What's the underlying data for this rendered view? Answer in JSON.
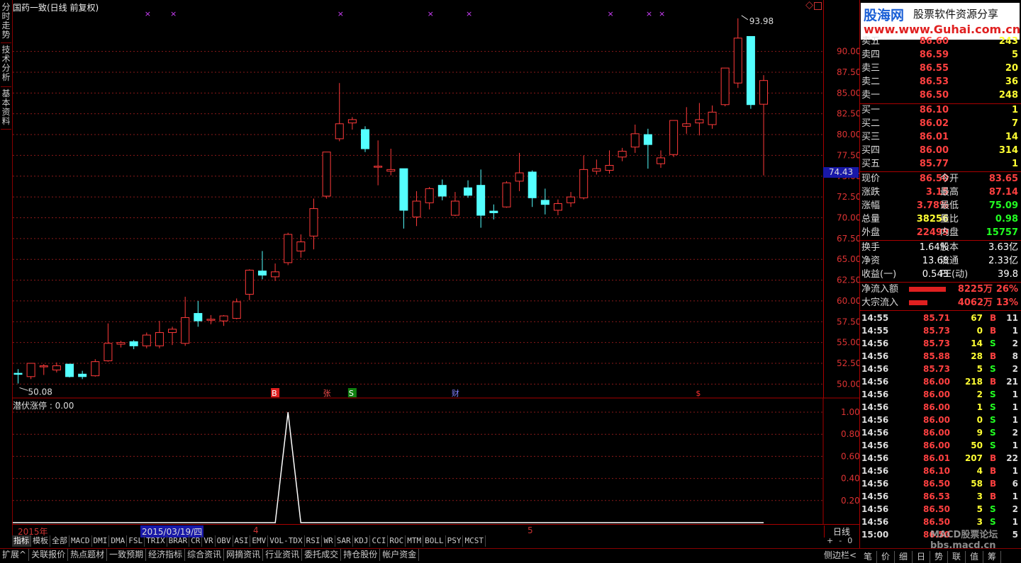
{
  "vertical_tabs": [
    "分时走势",
    "技术分析",
    "基本资料"
  ],
  "chart_title": "国药一致(日线 前复权)",
  "price_axis_labels": [
    "90.00",
    "87.50",
    "85.00",
    "82.50",
    "80.00",
    "77.50",
    "75.00",
    "72.50",
    "70.00",
    "67.50",
    "65.00",
    "62.50",
    "60.00",
    "57.50",
    "55.00",
    "52.50",
    "50.00"
  ],
  "last_price_marker": "74.43",
  "high_label": "93.98",
  "low_label": "50.08",
  "event_markers": {
    "b": "B",
    "zhang": "张",
    "s": "S",
    "cai": "财",
    "dollar": "$"
  },
  "indicator": {
    "label": "潜伏涨停 : 0.00",
    "axis_labels": [
      "1.00",
      "0.80",
      "0.60",
      "0.40",
      "0.20"
    ]
  },
  "date_bar": {
    "year": "2015年",
    "cursor_date": "2015/03/19/四",
    "month4": "4",
    "month5": "5",
    "period": "日线",
    "side_btns": [
      "+",
      "-",
      "0"
    ]
  },
  "indicator_tabs": [
    "指标",
    "模板",
    "全部",
    "MACD",
    "DMI",
    "DMA",
    "FSL",
    "TRIX",
    "BRAR",
    "CR",
    "VR",
    "OBV",
    "ASI",
    "EMV",
    "VOL-TDX",
    "RSI",
    "WR",
    "SAR",
    "KDJ",
    "CCI",
    "ROC",
    "MTM",
    "BOLL",
    "PSY",
    "MCST"
  ],
  "bottom_tabs": [
    "扩展^",
    "关联报价",
    "热点题材",
    "一致预期",
    "经济指标",
    "综合资讯",
    "网摘资讯",
    "行业资讯",
    "委托成交",
    "持仓股份",
    "帐户资金"
  ],
  "side_toggle": "侧边栏<",
  "side_bottom_tabs": [
    "笔",
    "价",
    "细",
    "日",
    "势",
    "联",
    "值",
    "筹"
  ],
  "logo": {
    "brand": "股海网",
    "slogan": "股票软件资源分享",
    "url": "www.Guhai.com.cn"
  },
  "watermark": "MACD股票论坛 bbs.macd.cn",
  "order_book": {
    "sells": [
      {
        "label": "卖五",
        "price": "86.60",
        "vol": "243"
      },
      {
        "label": "卖四",
        "price": "86.59",
        "vol": "5"
      },
      {
        "label": "卖三",
        "price": "86.55",
        "vol": "20"
      },
      {
        "label": "卖二",
        "price": "86.53",
        "vol": "36"
      },
      {
        "label": "卖一",
        "price": "86.50",
        "vol": "248"
      }
    ],
    "buys": [
      {
        "label": "买一",
        "price": "86.10",
        "vol": "1"
      },
      {
        "label": "买二",
        "price": "86.02",
        "vol": "7"
      },
      {
        "label": "买三",
        "price": "86.01",
        "vol": "14"
      },
      {
        "label": "买四",
        "price": "86.00",
        "vol": "314"
      },
      {
        "label": "买五",
        "price": "85.77",
        "vol": "1"
      }
    ]
  },
  "quote": [
    {
      "l1": "现价",
      "v1": "86.50",
      "l2": "今开",
      "v2": "83.65",
      "c1": "red",
      "c2": "red"
    },
    {
      "l1": "涨跌",
      "v1": "3.15",
      "l2": "最高",
      "v2": "87.14",
      "c1": "red",
      "c2": "red"
    },
    {
      "l1": "涨幅",
      "v1": "3.78%",
      "l2": "最低",
      "v2": "75.09",
      "c1": "red",
      "c2": "green"
    },
    {
      "l1": "总量",
      "v1": "38256",
      "l2": "量比",
      "v2": "0.98",
      "c1": "yellow",
      "c2": "green"
    },
    {
      "l1": "外盘",
      "v1": "22499",
      "l2": "内盘",
      "v2": "15757",
      "c1": "red",
      "c2": "green"
    }
  ],
  "fundamentals": [
    {
      "l1": "换手",
      "v1": "1.64%",
      "l2": "股本",
      "v2": "3.63亿"
    },
    {
      "l1": "净资",
      "v1": "13.68",
      "l2": "流通",
      "v2": "2.33亿"
    },
    {
      "l1": "收益(一)",
      "v1": "0.543",
      "l2": "PE(动)",
      "v2": "39.8"
    }
  ],
  "flows": [
    {
      "label": "净流入额",
      "value": "8225万",
      "pct": "26%",
      "bar": 0.26
    },
    {
      "label": "大宗流入",
      "value": "4062万",
      "pct": "13%",
      "bar": 0.13
    }
  ],
  "ticks": [
    {
      "t": "14:55",
      "p": "85.71",
      "v": "67",
      "bs": "B",
      "n": "11"
    },
    {
      "t": "14:55",
      "p": "85.73",
      "v": "0",
      "bs": "B",
      "n": "1"
    },
    {
      "t": "14:56",
      "p": "85.73",
      "v": "14",
      "bs": "S",
      "n": "2"
    },
    {
      "t": "14:56",
      "p": "85.88",
      "v": "28",
      "bs": "B",
      "n": "8"
    },
    {
      "t": "14:56",
      "p": "85.73",
      "v": "5",
      "bs": "S",
      "n": "2"
    },
    {
      "t": "14:56",
      "p": "86.00",
      "v": "218",
      "bs": "B",
      "n": "21"
    },
    {
      "t": "14:56",
      "p": "86.00",
      "v": "2",
      "bs": "S",
      "n": "1"
    },
    {
      "t": "14:56",
      "p": "86.00",
      "v": "1",
      "bs": "S",
      "n": "1"
    },
    {
      "t": "14:56",
      "p": "86.00",
      "v": "0",
      "bs": "S",
      "n": "1"
    },
    {
      "t": "14:56",
      "p": "86.00",
      "v": "9",
      "bs": "S",
      "n": "2"
    },
    {
      "t": "14:56",
      "p": "86.00",
      "v": "50",
      "bs": "S",
      "n": "1"
    },
    {
      "t": "14:56",
      "p": "86.01",
      "v": "207",
      "bs": "B",
      "n": "22"
    },
    {
      "t": "14:56",
      "p": "86.10",
      "v": "4",
      "bs": "B",
      "n": "1"
    },
    {
      "t": "14:56",
      "p": "86.50",
      "v": "58",
      "bs": "B",
      "n": "6"
    },
    {
      "t": "14:56",
      "p": "86.53",
      "v": "3",
      "bs": "B",
      "n": "1"
    },
    {
      "t": "14:56",
      "p": "86.50",
      "v": "5",
      "bs": "S",
      "n": "2"
    },
    {
      "t": "14:56",
      "p": "86.50",
      "v": "3",
      "bs": "S",
      "n": "1"
    },
    {
      "t": "15:00",
      "p": "86.50",
      "v": "",
      "bs": "",
      "n": "5"
    }
  ],
  "chart_data": {
    "type": "candlestick",
    "title": "国药一致(日线 前复权)",
    "y_range": [
      48.5,
      95.5
    ],
    "candles": [
      [
        51.3,
        51.8,
        50.08,
        51.2
      ],
      [
        50.9,
        52.5,
        50.6,
        52.5
      ],
      [
        52.2,
        52.4,
        51.1,
        52.2
      ],
      [
        51.7,
        52.6,
        51.4,
        52.2
      ],
      [
        52.4,
        52.4,
        50.8,
        50.9
      ],
      [
        51.2,
        51.6,
        50.6,
        50.9
      ],
      [
        51.0,
        53.0,
        50.9,
        52.7
      ],
      [
        52.8,
        57.3,
        52.7,
        54.9
      ],
      [
        54.8,
        55.2,
        54.4,
        55.0
      ],
      [
        55.1,
        55.3,
        54.2,
        54.6
      ],
      [
        54.6,
        56.2,
        54.3,
        55.9
      ],
      [
        54.6,
        57.6,
        54.3,
        56.2
      ],
      [
        56.2,
        56.9,
        54.7,
        56.6
      ],
      [
        54.9,
        60.5,
        54.6,
        58.0
      ],
      [
        58.5,
        60.0,
        56.9,
        57.6
      ],
      [
        57.8,
        58.3,
        57.2,
        57.8
      ],
      [
        57.6,
        58.3,
        57.0,
        58.2
      ],
      [
        57.9,
        60.3,
        57.8,
        59.9
      ],
      [
        60.8,
        63.8,
        60.1,
        63.7
      ],
      [
        63.6,
        66.0,
        62.6,
        63.1
      ],
      [
        62.9,
        64.5,
        62.4,
        63.5
      ],
      [
        64.6,
        68.2,
        64.3,
        68.0
      ],
      [
        66.0,
        68.0,
        65.2,
        67.1
      ],
      [
        67.8,
        72.3,
        66.2,
        71.1
      ],
      [
        72.6,
        75.8,
        72.3,
        77.9
      ],
      [
        79.5,
        86.2,
        79.2,
        81.3
      ],
      [
        81.4,
        82.1,
        80.6,
        81.8
      ],
      [
        80.6,
        81.0,
        77.9,
        78.3
      ],
      [
        76.1,
        79.3,
        73.9,
        76.2
      ],
      [
        75.6,
        78.3,
        75.1,
        75.8
      ],
      [
        75.9,
        75.9,
        68.7,
        70.9
      ],
      [
        70.1,
        73.2,
        69.0,
        72.0
      ],
      [
        71.8,
        73.7,
        71.0,
        73.5
      ],
      [
        73.9,
        74.6,
        72.1,
        72.6
      ],
      [
        70.3,
        73.1,
        70.2,
        72.0
      ],
      [
        73.6,
        74.5,
        72.4,
        72.7
      ],
      [
        73.9,
        75.8,
        68.8,
        70.3
      ],
      [
        70.8,
        71.6,
        69.8,
        70.6
      ],
      [
        71.3,
        74.4,
        71.2,
        74.2
      ],
      [
        74.4,
        77.8,
        73.2,
        75.4
      ],
      [
        75.5,
        75.7,
        71.3,
        72.4
      ],
      [
        72.1,
        73.5,
        70.4,
        71.6
      ],
      [
        70.9,
        72.2,
        70.3,
        71.7
      ],
      [
        71.8,
        73.1,
        71.3,
        72.5
      ],
      [
        72.4,
        77.5,
        72.2,
        75.8
      ],
      [
        75.6,
        77.0,
        75.2,
        75.9
      ],
      [
        75.7,
        78.1,
        75.3,
        76.3
      ],
      [
        77.3,
        78.4,
        76.8,
        78.0
      ],
      [
        78.5,
        81.2,
        77.8,
        80.1
      ],
      [
        80.0,
        80.7,
        75.9,
        78.8
      ],
      [
        76.5,
        78.1,
        76.0,
        77.2
      ],
      [
        77.6,
        81.5,
        77.3,
        81.7
      ],
      [
        81.0,
        83.3,
        80.1,
        81.3
      ],
      [
        81.4,
        83.8,
        79.9,
        81.8
      ],
      [
        81.2,
        83.5,
        80.7,
        82.7
      ],
      [
        83.6,
        87.5,
        83.4,
        88.0
      ],
      [
        86.2,
        93.98,
        85.6,
        91.6
      ],
      [
        91.8,
        91.8,
        83.1,
        83.6
      ],
      [
        83.65,
        87.14,
        75.09,
        86.5
      ]
    ],
    "indicator_series": {
      "name": "潜伏涨停",
      "peak_index": 21,
      "peak_value": 1.0,
      "y_range": [
        0,
        1.05
      ]
    }
  }
}
